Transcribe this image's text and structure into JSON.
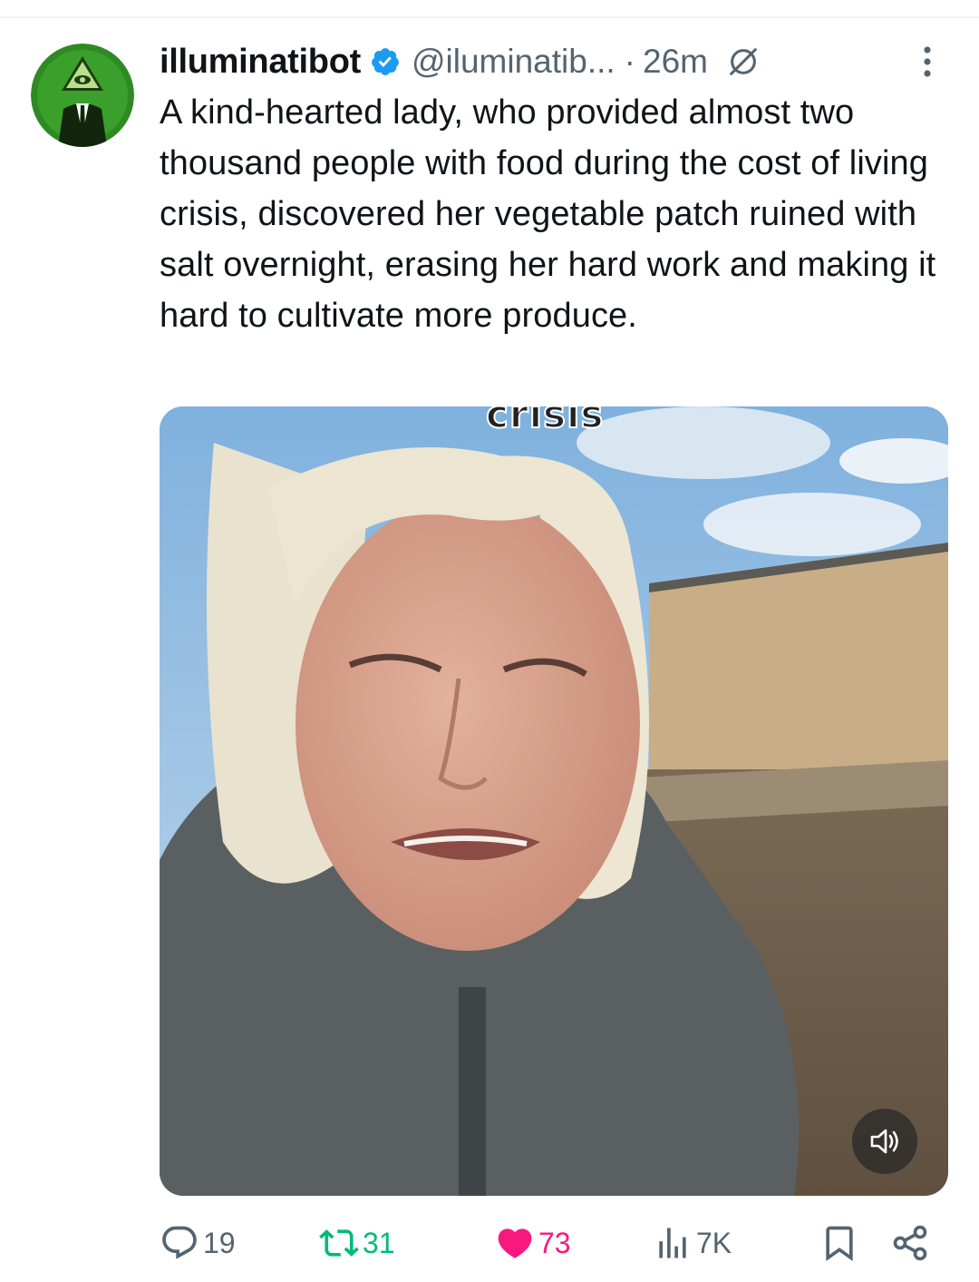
{
  "tweet": {
    "author_name": "illuminatibot",
    "handle": "@iluminatib...",
    "separator": "·",
    "time": "26m",
    "text": "A kind-hearted lady, who provided almost two thousand people with food during the cost of living crisis, discovered her vegetable patch ruined with salt overnight, erasing her hard work and making it hard to cultivate more produce."
  },
  "media": {
    "caption_text": "crisis"
  },
  "actions": {
    "replies": "19",
    "retweets": "31",
    "likes": "73",
    "views": "7K"
  },
  "colors": {
    "verified": "#1d9bf0",
    "retweet": "#00ba7c",
    "like": "#f91880",
    "muted": "#536471",
    "avatar_bg": "#2f8a23"
  },
  "icons": [
    "verified-badge-icon",
    "grok-icon",
    "more-options-icon",
    "volume-icon",
    "reply-icon",
    "retweet-icon",
    "like-icon",
    "views-icon",
    "bookmark-icon",
    "share-icon"
  ]
}
